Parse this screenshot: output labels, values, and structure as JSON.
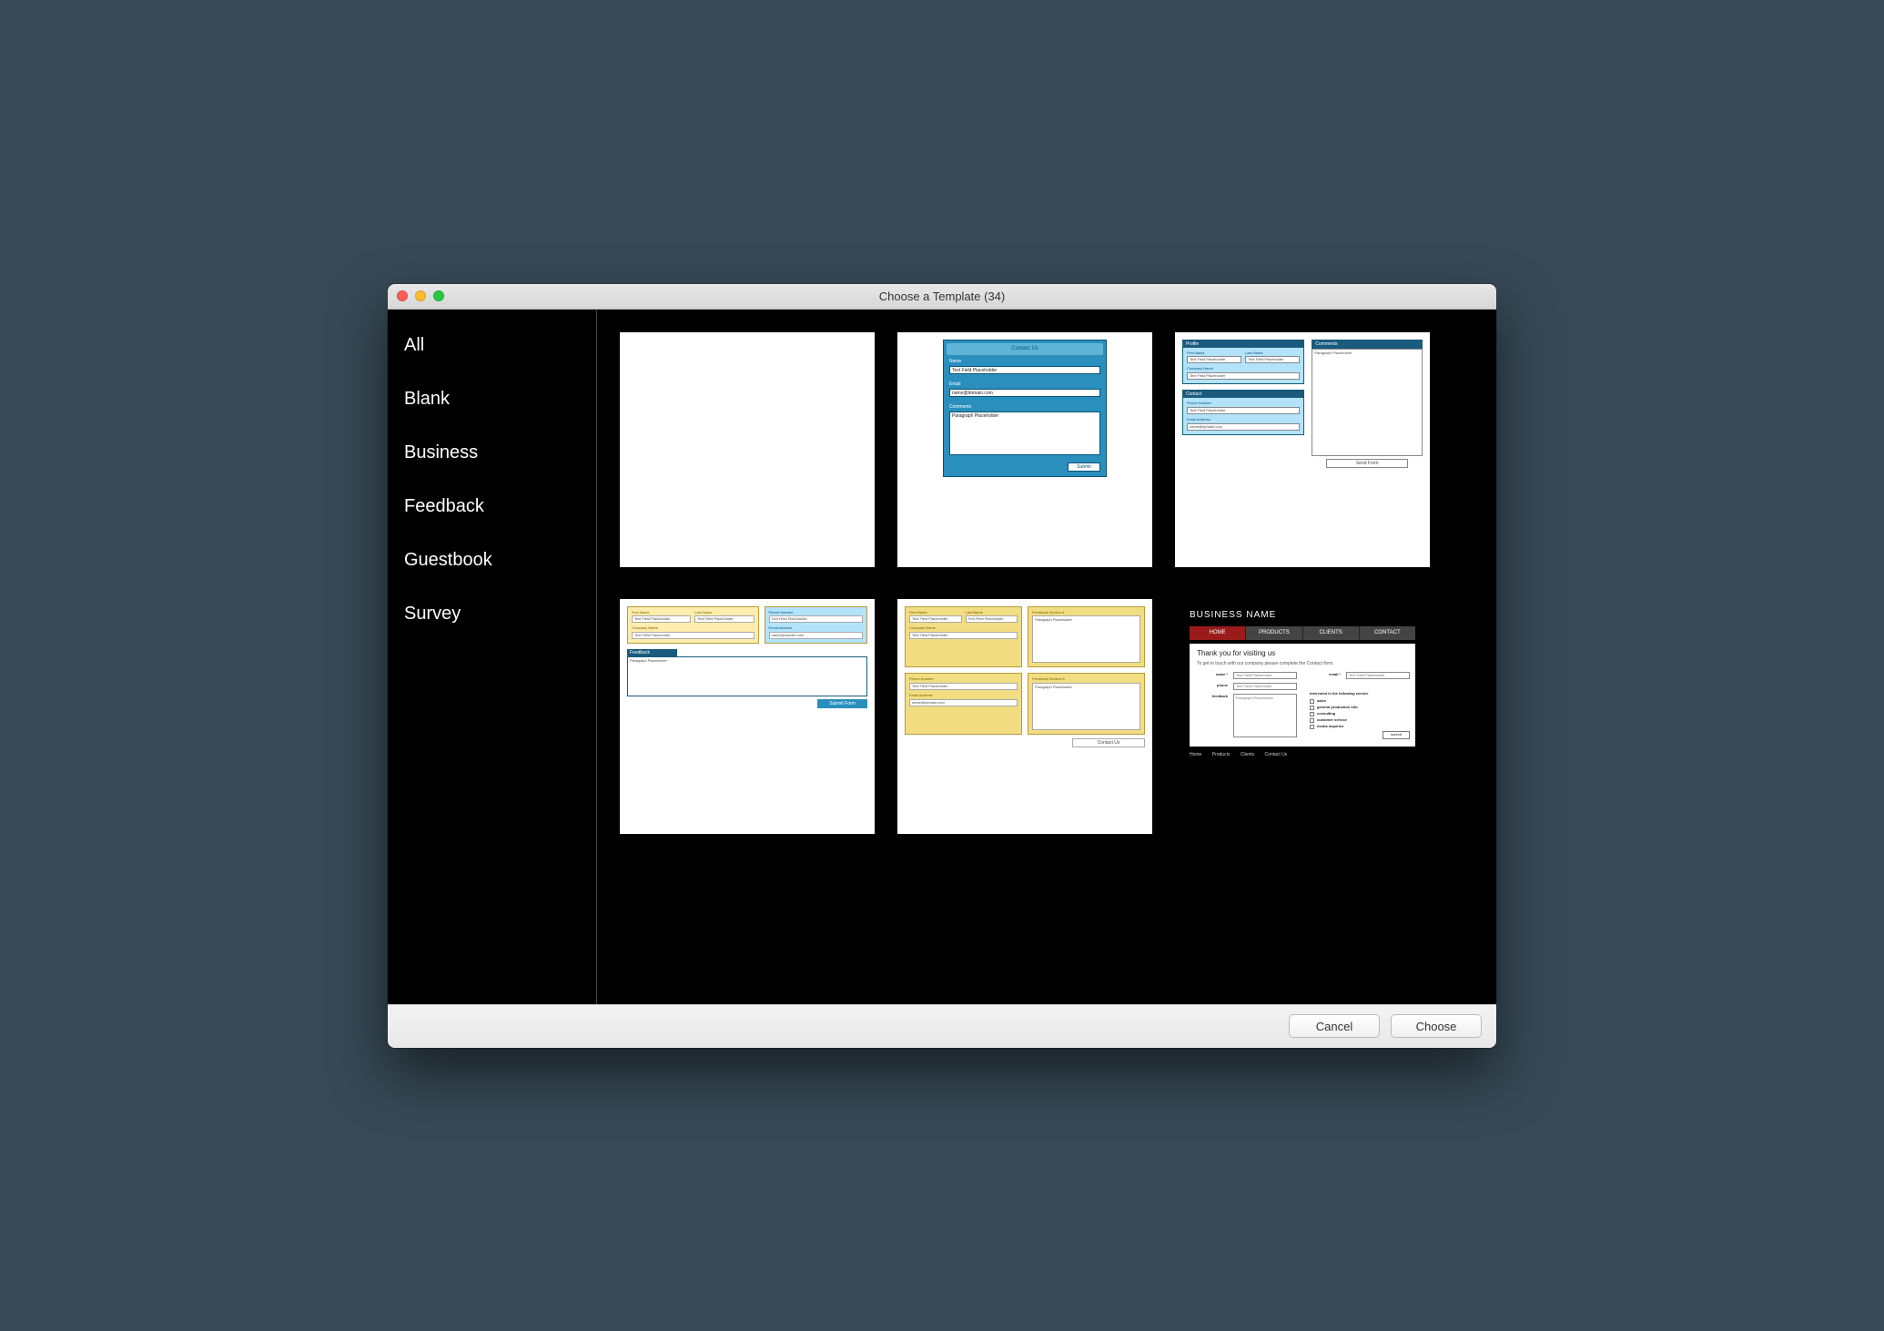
{
  "window": {
    "title": "Choose a Template (34)"
  },
  "sidebar": {
    "items": [
      {
        "label": "All"
      },
      {
        "label": "Blank"
      },
      {
        "label": "Business"
      },
      {
        "label": "Feedback"
      },
      {
        "label": "Guestbook"
      },
      {
        "label": "Survey"
      }
    ]
  },
  "thumbs": {
    "t2": {
      "header": "Contact Us",
      "name_label": "Name",
      "name_ph": "Text Field Placeholder",
      "email_label": "Email",
      "email_ph": "name@domain.com",
      "comments_label": "Comments",
      "comments_ph": "Paragraph Placeholder",
      "submit": "Submit"
    },
    "t3": {
      "profile_head": "Profile",
      "first_name": "First Name",
      "last_name": "Last Name",
      "tfp": "Text Field Placeholder",
      "company_label": "Company Name",
      "contact_head": "Contact",
      "phone_label": "Phone Number",
      "email_label": "Email Address",
      "email_ph": "name@domain.com",
      "comments_head": "Comments",
      "pp": "Paragraph Placeholder",
      "send": "Send Form"
    },
    "t4": {
      "first_name": "First Name",
      "last_name": "Last Name",
      "tfp": "Text Field Placeholder",
      "company": "Company Name",
      "phone": "Phone Number",
      "email": "Email Address",
      "email_ph": "name@domain.com",
      "feedback": "Feedback",
      "pp": "Paragraph Placeholder",
      "submit": "Submit Form"
    },
    "t5": {
      "first_name": "First Name",
      "last_name": "Last Name",
      "tfp": "Text Field Placeholder",
      "company": "Company Name",
      "phone": "Phone Number",
      "email": "Email Address",
      "email_ph": "name@domain.com",
      "fa": "Feedback Section A",
      "fb": "Feedback Section B",
      "pp": "Paragraph Placeholder",
      "contact": "Contact Us"
    },
    "t6": {
      "brand": "BUSINESS NAME",
      "nav": [
        "HOME",
        "PRODUCTS",
        "CLIENTS",
        "CONTACT"
      ],
      "h1": "Thank you for visiting us",
      "sub": "To get in touch with our company please complete the Contact form.",
      "name_l": "name *",
      "email_l": "email *",
      "phone_l": "phone",
      "feedback_l": "feedback",
      "tfp": "Text Field Placeholder",
      "pp": "Paragraph Placeholder",
      "services_head": "interested in the following service",
      "services": [
        "sales",
        "general production info",
        "consulting",
        "customer service",
        "media inquiries"
      ],
      "submit": "submit",
      "footer_links": [
        "Home",
        "Products",
        "Clients",
        "Contact Us"
      ]
    }
  },
  "footer": {
    "cancel": "Cancel",
    "choose": "Choose"
  }
}
